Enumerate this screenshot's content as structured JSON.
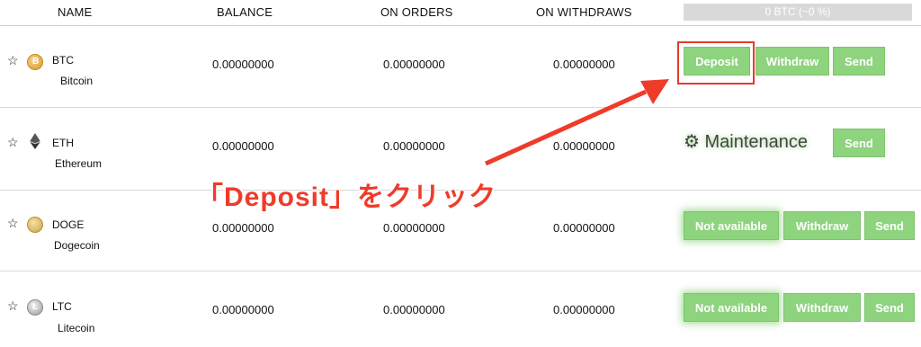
{
  "columns": {
    "name": "NAME",
    "balance": "BALANCE",
    "on_orders": "ON ORDERS",
    "on_withdraws": "ON WITHDRAWS",
    "summary": "0 BTC (~0 %)"
  },
  "rows": [
    {
      "symbol": "BTC",
      "name": "Bitcoin",
      "balance": "0.00000000",
      "orders": "0.00000000",
      "withdraws": "0.00000000",
      "deposit": "Deposit",
      "withdraw": "Withdraw",
      "send": "Send"
    },
    {
      "symbol": "ETH",
      "name": "Ethereum",
      "balance": "0.00000000",
      "orders": "0.00000000",
      "withdraws": "0.00000000",
      "status": "Maintenance",
      "send": "Send"
    },
    {
      "symbol": "DOGE",
      "name": "Dogecoin",
      "balance": "0.00000000",
      "orders": "0.00000000",
      "withdraws": "0.00000000",
      "status": "Not available",
      "withdraw": "Withdraw",
      "send": "Send"
    },
    {
      "symbol": "LTC",
      "name": "Litecoin",
      "balance": "0.00000000",
      "orders": "0.00000000",
      "withdraws": "0.00000000",
      "status": "Not available",
      "withdraw": "Withdraw",
      "send": "Send"
    }
  ],
  "annotation": "「Deposit」をクリック",
  "icons": {
    "star": "star-outline-icon",
    "gear": "gear-icon"
  },
  "colors": {
    "button": "#8ed37e",
    "annotation": "#ef3b2a",
    "progress": "#d9d9d9"
  }
}
